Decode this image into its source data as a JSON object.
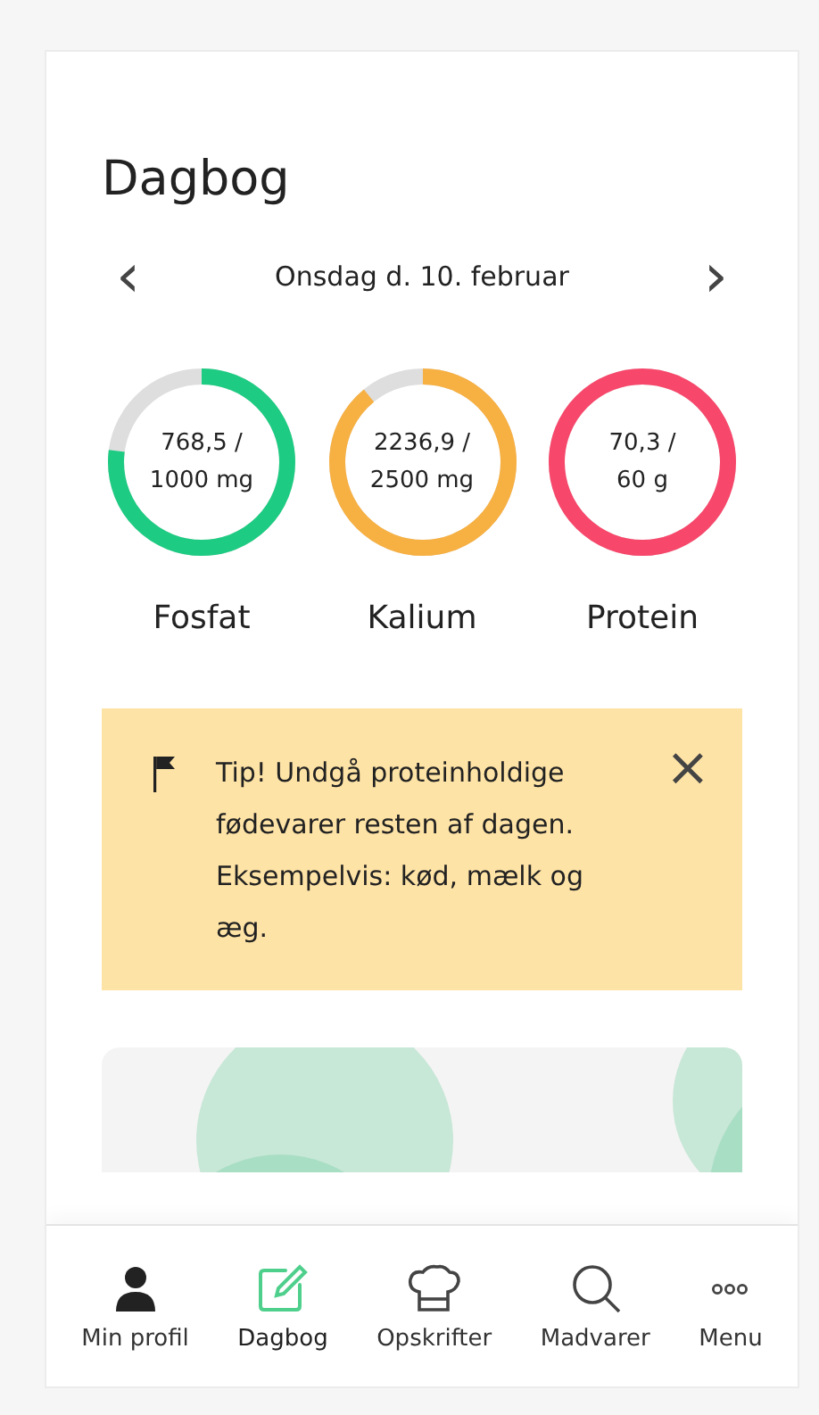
{
  "title": "Dagbog",
  "date_nav": {
    "prev": "‹",
    "label": "Onsdag d. 10. februar",
    "next": "›"
  },
  "nutrients": [
    {
      "name": "Fosfat",
      "amount": "768,5 /",
      "limit": "1000 mg",
      "level": 0.77,
      "color": "#1ecb82"
    },
    {
      "name": "Kalium",
      "amount": "2236,9 /",
      "limit": "2500 mg",
      "level": 0.89,
      "color": "#f7b042"
    },
    {
      "name": "Protein",
      "amount": "70,3 /",
      "limit": "60 g",
      "level": 1,
      "color": "#f7476b"
    }
  ],
  "tip": {
    "text": "Tip! Undgå proteinholdige fødevarer resten af dagen. Eksempelvis: kød, mælk og æg.",
    "close": "×"
  },
  "bottom_nav": [
    {
      "label": "Min profil",
      "kind": "profile",
      "selected": false
    },
    {
      "label": "Dagbog",
      "kind": "diary",
      "selected": true
    },
    {
      "label": "Opskrifter",
      "kind": "recipes",
      "selected": false
    },
    {
      "label": "Madvarer",
      "kind": "search",
      "selected": false
    },
    {
      "label": "Menu",
      "kind": "more",
      "selected": false
    }
  ]
}
